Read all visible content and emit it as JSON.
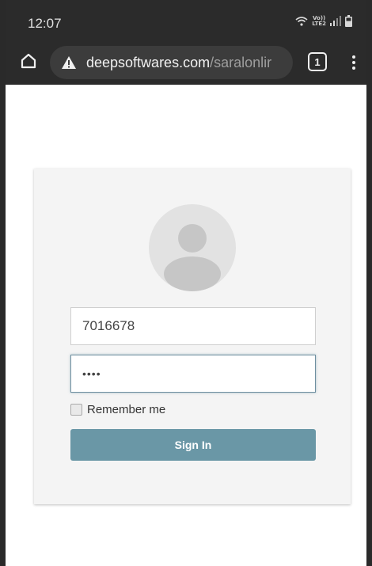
{
  "status_bar": {
    "time": "12:07",
    "network_label_top": "Vo))",
    "network_label_bottom": "LTE2",
    "icons": [
      "wifi-icon",
      "signal-icon",
      "battery-icon"
    ]
  },
  "browser": {
    "url_domain": "deepsoftwares.com",
    "url_path": "/saralonlir",
    "tab_count": "1",
    "icons": [
      "home-icon",
      "warning-icon",
      "tabs-icon",
      "more-vert-icon"
    ]
  },
  "login": {
    "username_value": "7016678",
    "password_mask": "••••",
    "remember_label": "Remember me",
    "signin_label": "Sign In",
    "avatar_icon": "user-avatar-icon"
  },
  "colors": {
    "chrome_bg": "#2b2b2b",
    "card_bg": "#f4f4f4",
    "button_bg": "#6a97a6",
    "focus_border": "#6f8fa0"
  }
}
